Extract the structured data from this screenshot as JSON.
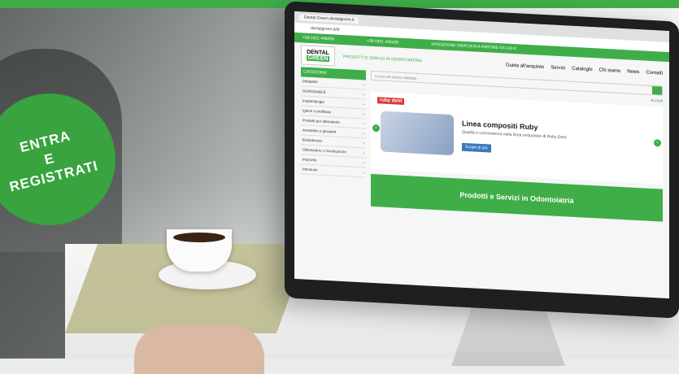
{
  "badge": {
    "line1": "ENTRA",
    "line2": "E",
    "line3": "REGISTRATI"
  },
  "site": {
    "tab_title": "Dental Green dentalgreen.it",
    "url": "dentalgreen.it/it/",
    "strip_phone": "+39 0321 448459",
    "strip_mobile": "+39 0321 445435",
    "strip_shipping": "SPEDIZIONE GRATUITA A PARTIRE DA 140 €",
    "logo_line1": "DENTAL",
    "logo_line2": "GREEN",
    "tagline": "PRODOTTI E SERVIZI IN ODONTOIATRIA",
    "nav": [
      "Guida all'acquisto",
      "Servizi",
      "Cataloghi",
      "Chi siamo",
      "News",
      "Contatti"
    ],
    "categories_label": "CATEGORIE",
    "sidebar_items": [
      "PRIMARI",
      "DISPOSABLE",
      "Implantologia",
      "Igiene e profilassi",
      "Prodotti per laboratorio",
      "Anestetici e gessanti",
      "Endodonzia",
      "Otturazione e ricostruzione",
      "Impronte",
      "Monouso",
      "Conservativa",
      "Chirurgia",
      "Ortodonzia",
      "Frese e strumenti",
      "Strumenti odontoiatrici"
    ],
    "search_placeholder": "Cerca nel nostro catalogo",
    "account": "Accedi",
    "slide_brand": "ruby dent",
    "slide_title": "Linea compositi Ruby",
    "slide_sub": "Qualità e convenienza nella linea restorative di Ruby Dent",
    "slide_btn": "Scopri di più",
    "banner": "Prodotti e Servizi in Odontoiatria"
  }
}
